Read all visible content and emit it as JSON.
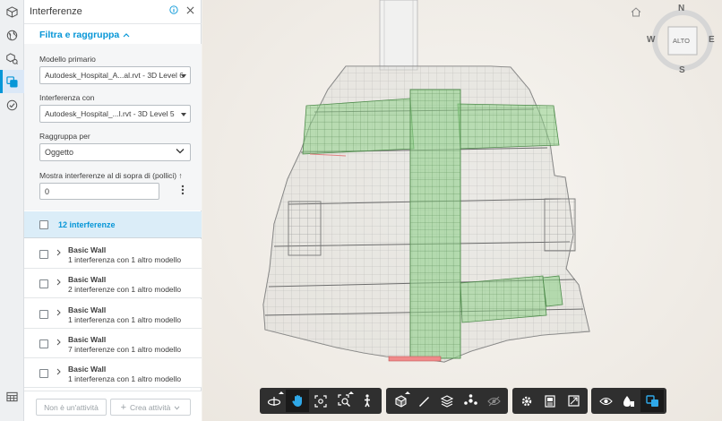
{
  "panel": {
    "title": "Interferenze",
    "filter_toggle": "Filtra e raggruppa",
    "primary_model_label": "Modello primario",
    "primary_model_value": "Autodesk_Hospital_A...al.rvt - 3D Level 6",
    "interference_with_label": "Interferenza con",
    "interference_with_value": "Autodesk_Hospital_...l.rvt - 3D Level 5",
    "group_by_label": "Raggruppa per",
    "group_by_value": "Oggetto",
    "threshold_label": "Mostra interferenze al di sopra di (pollici) ↑",
    "threshold_value": "0",
    "summary": "12 interferenze",
    "rows": [
      {
        "title": "Basic Wall",
        "sub": "1 interferenza con 1 altro modello"
      },
      {
        "title": "Basic Wall",
        "sub": "2 interferenze con 1 altro modello"
      },
      {
        "title": "Basic Wall",
        "sub": "1 interferenza con 1 altro modello"
      },
      {
        "title": "Basic Wall",
        "sub": "7 interferenze con 1 altro modello"
      },
      {
        "title": "Basic Wall",
        "sub": "1 interferenza con 1 altro modello"
      }
    ],
    "footer": {
      "no_activity": "Non è un'attività",
      "create_activity": "Crea attività"
    }
  },
  "viewcube": {
    "north": "N",
    "south": "S",
    "east": "E",
    "west": "W",
    "face": "ALTO"
  },
  "colors": {
    "accent": "#0696d7",
    "clash_green": "#8fd18b",
    "toolbar_bg": "#2f2f2f"
  }
}
